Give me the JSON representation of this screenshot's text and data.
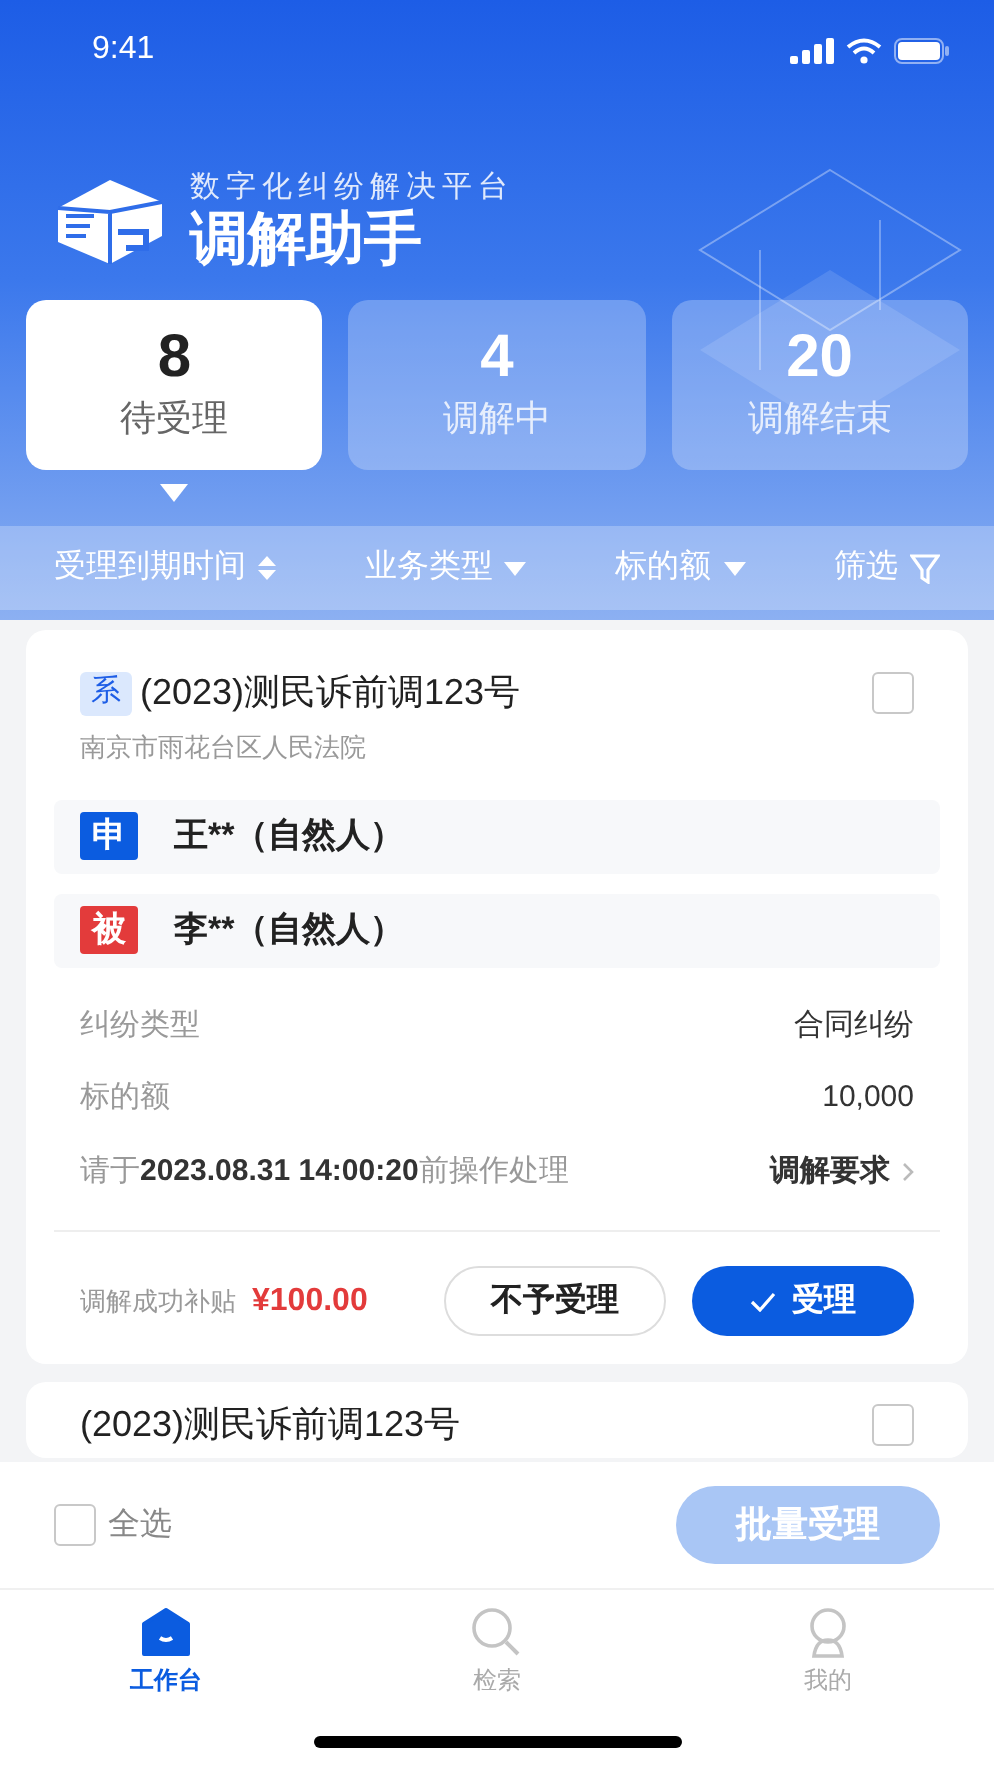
{
  "status_bar": {
    "time": "9:41"
  },
  "header": {
    "subtitle": "数字化纠纷解决平台",
    "title": "调解助手"
  },
  "tabs": [
    {
      "count": "8",
      "label": "待受理",
      "selected": true
    },
    {
      "count": "4",
      "label": "调解中",
      "selected": false
    },
    {
      "count": "20",
      "label": "调解结束",
      "selected": false
    }
  ],
  "filters": [
    {
      "label": "受理到期时间",
      "kind": "sort"
    },
    {
      "label": "业务类型",
      "kind": "dropdown"
    },
    {
      "label": "标的额",
      "kind": "dropdown"
    },
    {
      "label": "筛选",
      "kind": "filter"
    }
  ],
  "cards": [
    {
      "tag": "系",
      "case_no": "(2023)测民诉前调123号",
      "court": "南京市雨花台区人民法院",
      "checked": false,
      "parties": [
        {
          "tag": "申",
          "name": "王**（自然人）",
          "color": "#0b5ce0"
        },
        {
          "tag": "被",
          "name": "李**（自然人）",
          "color": "#e33b3b"
        }
      ],
      "details": [
        {
          "label": "纠纷类型",
          "value": "合同纠纷"
        },
        {
          "label": "标的额",
          "value": "10,000"
        }
      ],
      "deadline": "请于**2023.08.31 14:00:20**前操作处理",
      "link": "调解要求",
      "subsidy_label": "调解成功补贴",
      "subsidy": "¥100.00",
      "reject": "不予受理",
      "accept": "受理"
    },
    {
      "case_no": "(2023)测民诉前调123号",
      "checked": false
    }
  ],
  "bottom_bar": {
    "select_all": "全选",
    "select_all_checked": false,
    "batch_button": "批量受理",
    "batch_disabled": true
  },
  "nav": [
    {
      "label": "工作台",
      "kind": "home",
      "selected": true
    },
    {
      "label": "检索",
      "kind": "search",
      "selected": false
    },
    {
      "label": "我的",
      "kind": "profile",
      "selected": false
    }
  ]
}
